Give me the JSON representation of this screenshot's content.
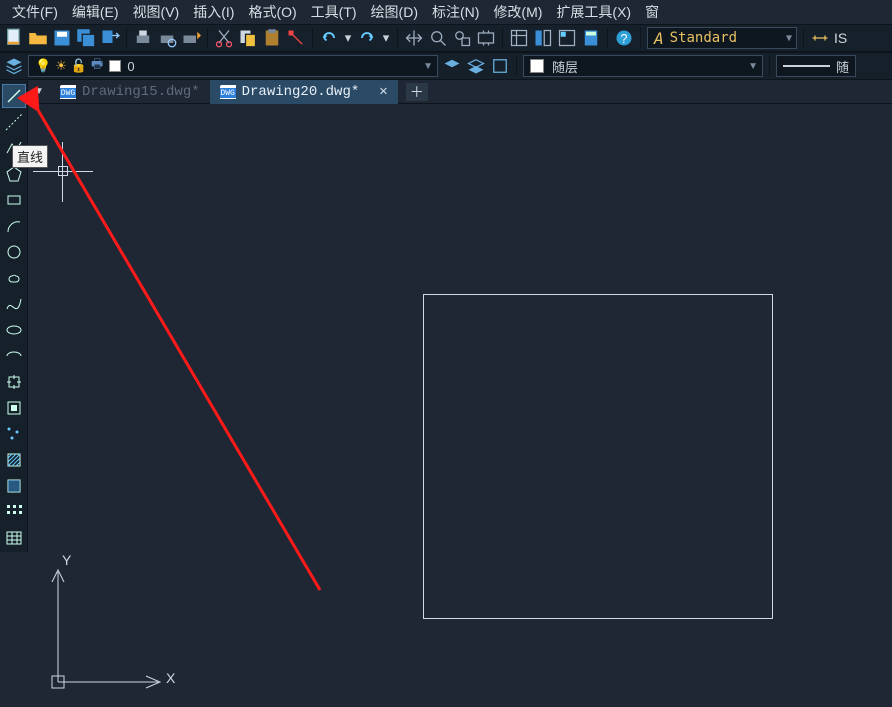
{
  "menu": {
    "file": "文件(F)",
    "edit": "编辑(E)",
    "view": "视图(V)",
    "insert": "插入(I)",
    "format": "格式(O)",
    "tools": "工具(T)",
    "paint": "绘图(D)",
    "dimension": "标注(N)",
    "modify": "修改(M)",
    "ext": "扩展工具(X)",
    "window": "窗"
  },
  "toolbar1": {
    "style_label": "Standard",
    "iso_label": "IS"
  },
  "toolbar2": {
    "layer_value": "0",
    "layer2_value": "随层",
    "linetype_suffix": "随"
  },
  "tabs": {
    "inactive": "Drawing15.dwg*",
    "active": "Drawing20.dwg*"
  },
  "tooltip": "直线",
  "ucs": {
    "x": "X",
    "y": "Y"
  },
  "icons": {
    "new": "new",
    "open": "open",
    "save": "save",
    "cut": "cut",
    "copy": "copy",
    "paste": "paste",
    "undo": "undo",
    "redo": "redo"
  }
}
